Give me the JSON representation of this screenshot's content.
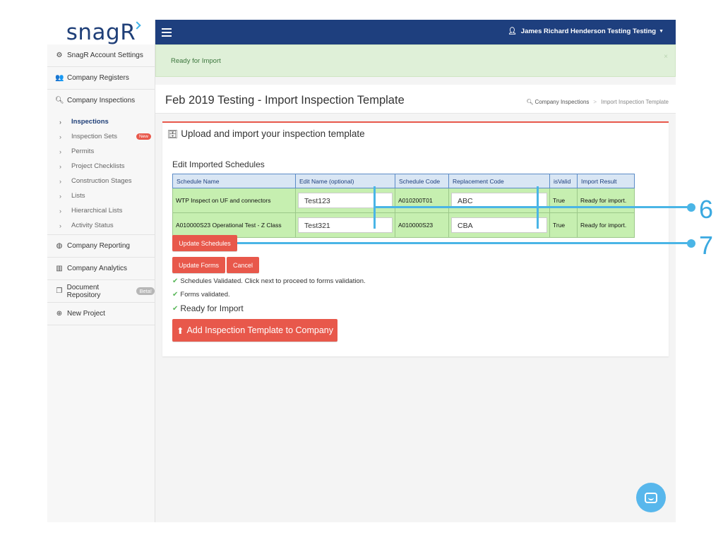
{
  "app": {
    "logo": "snagR"
  },
  "sidebar": {
    "items": [
      {
        "label": "SnagR Account Settings",
        "icon": "cogs-icon"
      },
      {
        "label": "Company Registers",
        "icon": "users-icon"
      },
      {
        "label": "Company Inspections",
        "icon": "search-icon"
      }
    ],
    "sub_items": [
      {
        "label": "Inspections",
        "active": true
      },
      {
        "label": "Inspection Sets",
        "badge": "New"
      },
      {
        "label": "Permits"
      },
      {
        "label": "Project Checklists"
      },
      {
        "label": "Construction Stages"
      },
      {
        "label": "Lists"
      },
      {
        "label": "Hierarchical Lists"
      },
      {
        "label": "Activity Status"
      }
    ],
    "items_after": [
      {
        "label": "Company Reporting",
        "icon": "globe-icon"
      },
      {
        "label": "Company Analytics",
        "icon": "bar-chart-icon"
      },
      {
        "label": "Document Repository",
        "icon": "files-icon",
        "badge": "Beta!"
      },
      {
        "label": "New Project",
        "icon": "plus-circle-icon"
      }
    ]
  },
  "topbar": {
    "user": "James Richard Henderson Testing Testing"
  },
  "alert": {
    "text": "Ready for Import",
    "close": "×"
  },
  "page": {
    "title": "Feb 2019 Testing - Import Inspection Template",
    "breadcrumb": [
      "Company Inspections",
      "Import Inspection Template"
    ]
  },
  "box": {
    "title": "Upload and import your inspection template",
    "section": "Edit Imported Schedules",
    "table": {
      "headers": [
        "Schedule Name",
        "Edit Name (optional)",
        "Schedule Code",
        "Replacement Code",
        "isValid",
        "Import Result"
      ],
      "rows": [
        {
          "name": "WTP Inspect on UF and connectors",
          "edit_name": "Test123",
          "code": "A010200T01",
          "replacement": "ABC",
          "valid": "True",
          "result": "Ready for import."
        },
        {
          "name": "A010000S23 Operational Test - Z Class",
          "edit_name": "Test321",
          "code": "A010000S23",
          "replacement": "CBA",
          "valid": "True",
          "result": "Ready for import."
        }
      ]
    },
    "buttons": {
      "update_schedules": "Update Schedules",
      "update_forms": "Update Forms",
      "cancel": "Cancel",
      "add_template": "Add Inspection Template to Company"
    },
    "status": {
      "schedules_validated": "Schedules Validated. Click next to proceed to forms validation.",
      "forms_validated": "Forms validated.",
      "ready": "Ready for Import"
    }
  },
  "callouts": [
    "6",
    "7"
  ],
  "colors": {
    "accent": "#e8584b",
    "navy": "#1e3f7e",
    "callout": "#4ab5e6"
  }
}
